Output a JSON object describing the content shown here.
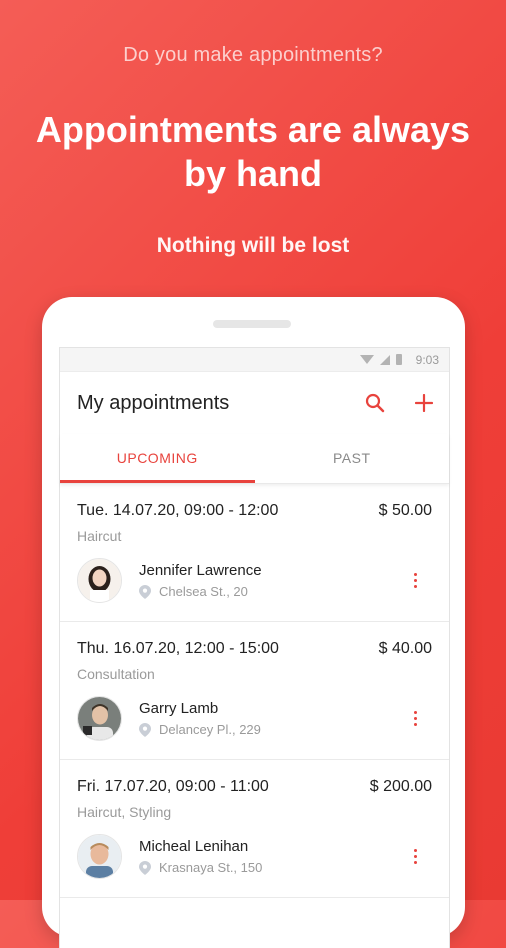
{
  "promo": {
    "question": "Do you make appointments?",
    "headline_line1": "Appointments are always",
    "headline_line2": "by hand",
    "tagline": "Nothing will be lost"
  },
  "statusbar": {
    "time": "9:03",
    "icons": [
      "wifi-icon",
      "signal-icon",
      "battery-icon"
    ]
  },
  "appbar": {
    "title": "My appointments",
    "actions": [
      "search-icon",
      "add-icon"
    ]
  },
  "tabs": [
    {
      "label": "UPCOMING",
      "active": true
    },
    {
      "label": "PAST",
      "active": false
    }
  ],
  "appointments": [
    {
      "datetime": "Tue. 14.07.20, 09:00 - 12:00",
      "price": "$ 50.00",
      "service": "Haircut",
      "client": "Jennifer Lawrence",
      "address": "Chelsea St., 20"
    },
    {
      "datetime": "Thu. 16.07.20, 12:00 - 15:00",
      "price": "$ 40.00",
      "service": "Consultation",
      "client": "Garry Lamb",
      "address": "Delancey Pl., 229"
    },
    {
      "datetime": "Fri. 17.07.20, 09:00 - 11:00",
      "price": "$ 200.00",
      "service": "Haircut, Styling",
      "client": "Micheal Lenihan",
      "address": "Krasnaya St., 150"
    }
  ],
  "colors": {
    "accent": "#e8433d",
    "background": "#ef3e38"
  }
}
